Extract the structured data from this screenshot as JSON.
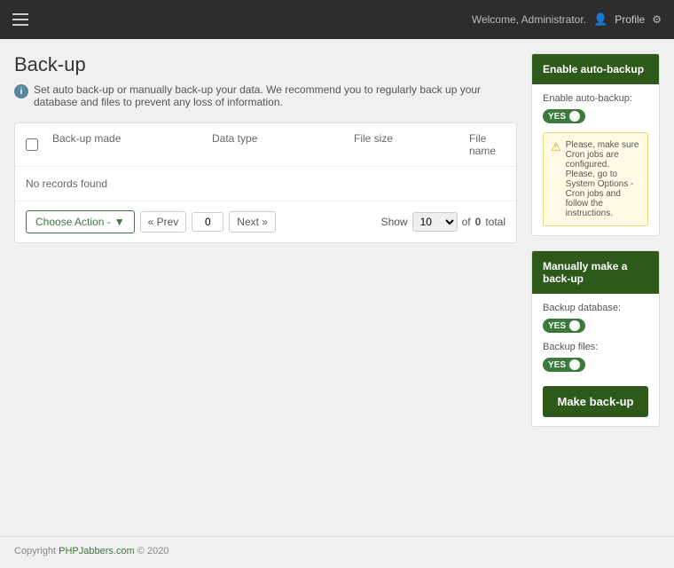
{
  "header": {
    "welcome_text": "Welcome, Administrator.",
    "profile_label": "Profile",
    "hamburger_label": "Menu"
  },
  "page": {
    "title": "Back-up",
    "description": "Set auto back-up or manually back-up your data. We recommend you to regularly back up your database and files to prevent any loss of information."
  },
  "table": {
    "columns": [
      "Back-up made",
      "Data type",
      "File size",
      "File name"
    ],
    "no_records": "No records found",
    "pagination": {
      "prev_label": "« Prev",
      "next_label": "Next »",
      "current_page": "0",
      "show_label": "Show",
      "per_page": "10",
      "total_prefix": "of",
      "total_count": "0",
      "total_suffix": "total"
    },
    "choose_action_label": "Choose Action -"
  },
  "sidebar": {
    "auto_backup": {
      "panel_title": "Enable auto-backup",
      "field_label": "Enable auto-backup:",
      "toggle_label": "YES",
      "warning_text": "Please, make sure Cron jobs are configured. Please, go to System Options - Cron jobs and follow the instructions."
    },
    "manual_backup": {
      "panel_title": "Manually make a back-up",
      "database_label": "Backup database:",
      "database_toggle": "YES",
      "files_label": "Backup files:",
      "files_toggle": "YES",
      "make_backup_button": "Make back-up"
    }
  },
  "footer": {
    "text_prefix": "Copyright",
    "brand": "PHPJabbers.com",
    "text_suffix": "© 2020"
  }
}
